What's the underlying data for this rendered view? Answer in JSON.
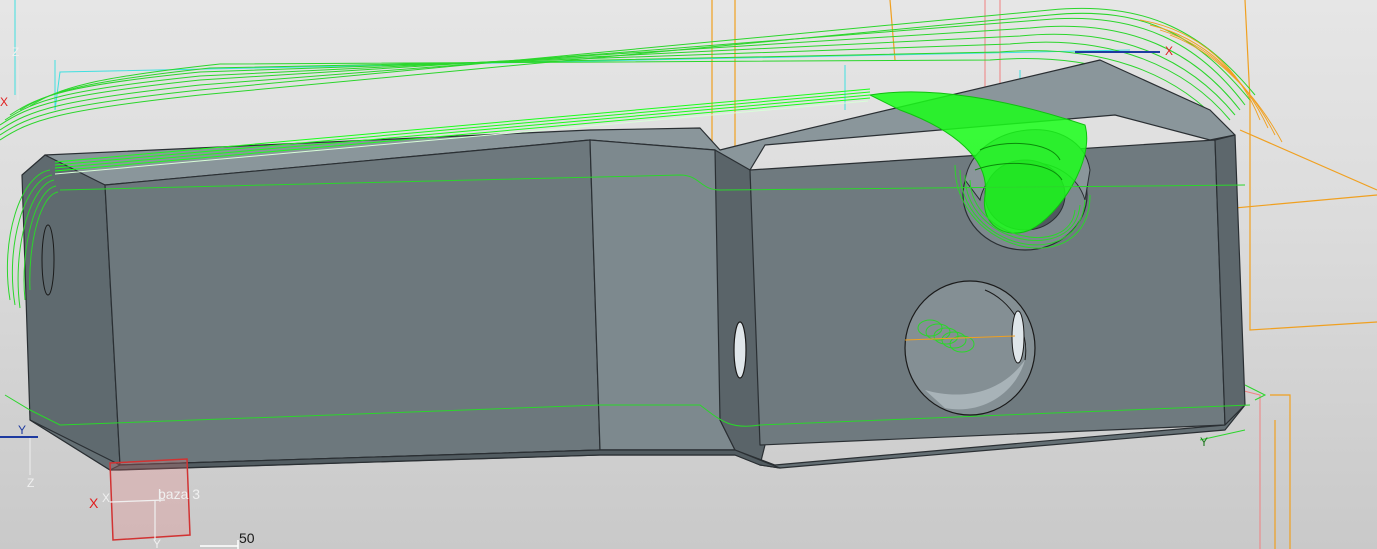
{
  "viewport": {
    "background_top": "#e6e6e6",
    "background_bottom": "#c9c9c9"
  },
  "colors": {
    "part_face": "#6d787d",
    "part_edge": "#2a2f33",
    "toolpath_green": "#2bd62b",
    "toolpath_bright": "#1aff1a",
    "stock_orange": "#f0a020",
    "fixture_red": "#d23232",
    "axis_x": "#e01e1e",
    "axis_y": "#1e7a1e",
    "axis_z": "#e8e8e8",
    "cyan_line": "#40e0e0",
    "pink_line": "#f08080"
  },
  "coordinate_systems": [
    {
      "name": "baza-3",
      "label": "baza 3",
      "x_label": "X",
      "y_label": "Y"
    },
    {
      "name": "left-csys",
      "x_label": "X",
      "y_label": "Y",
      "z_label": "Z"
    },
    {
      "name": "top-left-csys",
      "x_label": "X",
      "z_label": "Z"
    },
    {
      "name": "right-csys",
      "x_label": "X",
      "y_label": "Y"
    }
  ],
  "scale_bar": {
    "label": "50"
  }
}
